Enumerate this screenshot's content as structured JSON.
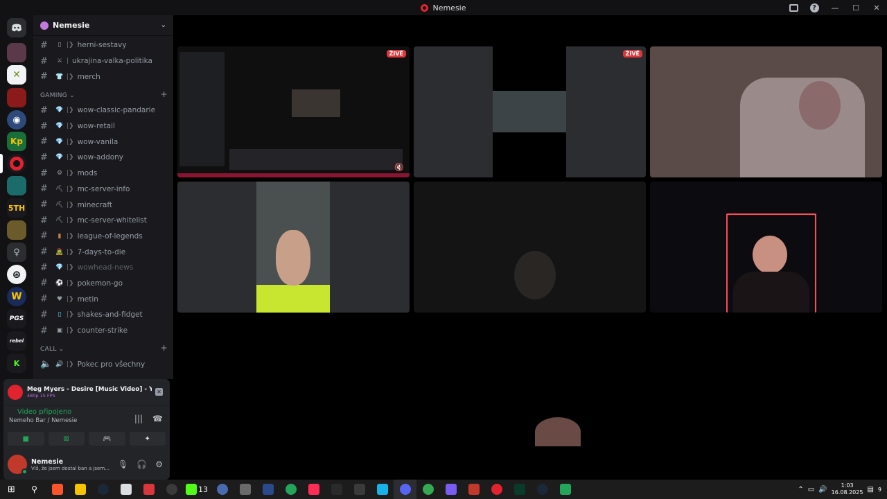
{
  "window": {
    "title": "Nemesie"
  },
  "guild": {
    "name": "Nemesie"
  },
  "channels_top": [
    {
      "name": "herni-sestavy",
      "emoji": "▯"
    },
    {
      "name": "ukrajina-valka-politika",
      "emoji": "⚔"
    },
    {
      "name": "merch",
      "emoji": "👕"
    }
  ],
  "category_gaming": {
    "label": "GAMING",
    "channels": [
      {
        "name": "wow-classic-pandarie",
        "emoji": "💎"
      },
      {
        "name": "wow-retail",
        "emoji": "💎"
      },
      {
        "name": "wow-vanila",
        "emoji": "💎"
      },
      {
        "name": "wow-addony",
        "emoji": "💎"
      },
      {
        "name": "mods",
        "emoji": "⚙"
      },
      {
        "name": "mc-server-info",
        "emoji": "⛏"
      },
      {
        "name": "minecraft",
        "emoji": "⛏"
      },
      {
        "name": "mc-server-whitelist",
        "emoji": "⛏"
      },
      {
        "name": "league-of-legends",
        "emoji": "▮"
      },
      {
        "name": "7-days-to-die",
        "emoji": "🧟"
      },
      {
        "name": "wowhead-news",
        "emoji": "💎"
      },
      {
        "name": "pokemon-go",
        "emoji": "⚽"
      },
      {
        "name": "metin",
        "emoji": "♥"
      },
      {
        "name": "shakes-and-fidget",
        "emoji": "▯"
      },
      {
        "name": "counter-strike",
        "emoji": "▣"
      }
    ]
  },
  "category_call": {
    "label": "CALL",
    "channels": [
      {
        "name": "Pokec pro všechny",
        "emoji": "🔊"
      }
    ]
  },
  "now_playing": {
    "title": "Meg Myers - Desire [Music Video] - YouTu...",
    "quality": "480p 15 FPS"
  },
  "voice": {
    "status": "Video připojeno",
    "channel": "Nemeho Bar / Nemesie"
  },
  "user": {
    "name": "Nemesie",
    "status": "Víš, že jsem dostal ban a jsem..."
  },
  "stage": {
    "live_label": "ŽIVĚ"
  },
  "taskbar": {
    "badge": "13",
    "time": "1:03",
    "date": "16.08.2025",
    "notifications": "9"
  },
  "colors": {
    "live": "#da373c",
    "accent": "#23a55a",
    "brand": "#e0232e"
  }
}
